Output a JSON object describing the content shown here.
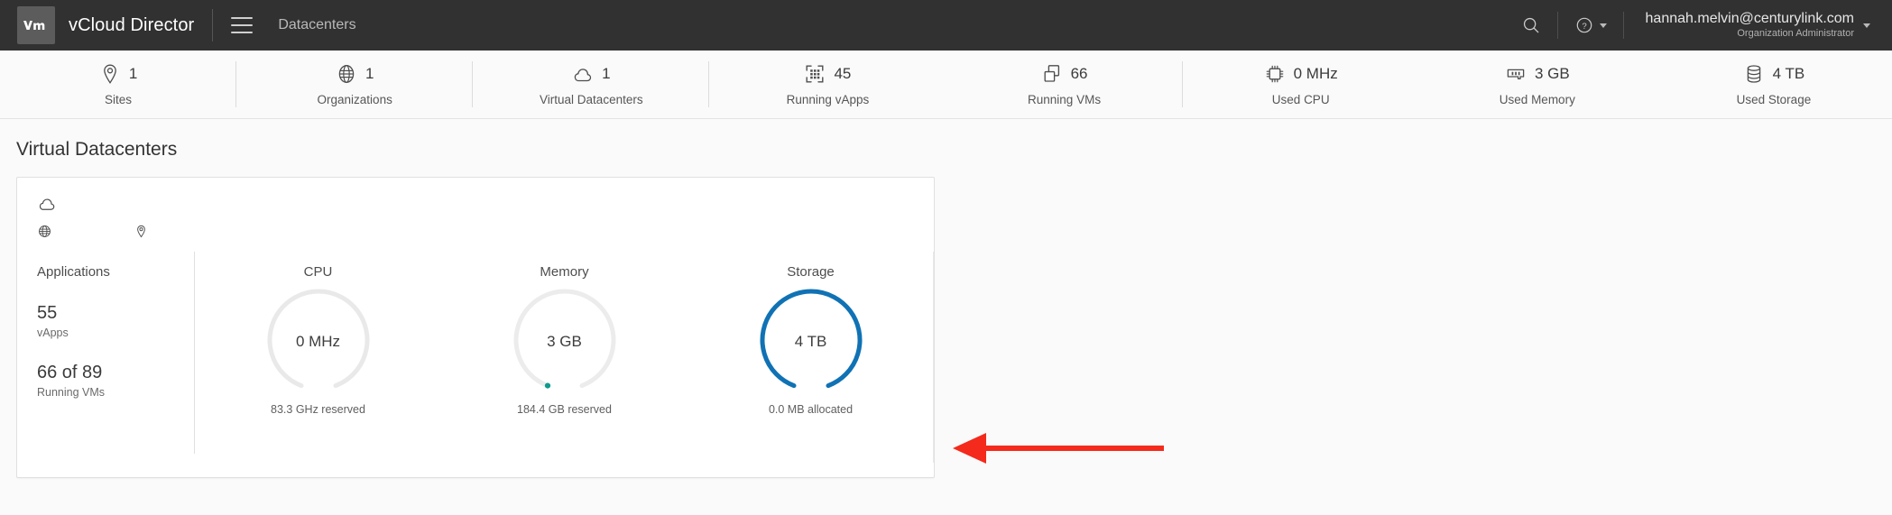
{
  "header": {
    "logo_text": "vm",
    "app_title": "vCloud Director",
    "menu_icon": "hamburger-icon",
    "breadcrumb": "Datacenters",
    "search_icon": "search-icon",
    "help_icon": "help-circle-icon",
    "user_email": "hannah.melvin@centurylink.com",
    "user_role": "Organization Administrator"
  },
  "stats": [
    {
      "icon": "location-pin-icon",
      "value": "1",
      "label": "Sites"
    },
    {
      "icon": "globe-icon",
      "value": "1",
      "label": "Organizations"
    },
    {
      "icon": "cloud-icon",
      "value": "1",
      "label": "Virtual Datacenters"
    },
    {
      "icon": "vapp-grid-icon",
      "value": "45",
      "label": "Running vApps"
    },
    {
      "icon": "vm-stack-icon",
      "value": "66",
      "label": "Running VMs"
    },
    {
      "icon": "cpu-chip-icon",
      "value": "0 MHz",
      "label": "Used CPU"
    },
    {
      "icon": "memory-stick-icon",
      "value": "3 GB",
      "label": "Used Memory"
    },
    {
      "icon": "storage-drum-icon",
      "value": "4 TB",
      "label": "Used Storage"
    }
  ],
  "page": {
    "title": "Virtual Datacenters"
  },
  "card": {
    "cloud_icon": "cloud-icon",
    "org_icon": "globe-icon",
    "org_name": "",
    "site_icon": "location-pin-icon",
    "site_name": "",
    "applications": {
      "title": "Applications",
      "vapps_count": "55",
      "vapps_label": "vApps",
      "vms_count": "66 of 89",
      "vms_label": "Running VMs"
    },
    "gauges": [
      {
        "title": "CPU",
        "center": "0 MHz",
        "footer": "83.3 GHz reserved",
        "track_color": "#e9e9e9",
        "arc_color": "#e9e9e9",
        "percent": 0,
        "dot": false
      },
      {
        "title": "Memory",
        "center": "3 GB",
        "footer": "184.4 GB reserved",
        "track_color": "#ececec",
        "arc_color": "#0f9a8c",
        "percent": 1,
        "dot": true,
        "dot_color": "#0f9a8c"
      },
      {
        "title": "Storage",
        "center": "4 TB",
        "footer": "0.0 MB allocated",
        "track_color": "#e9e9e9",
        "arc_color": "#1072b4",
        "percent": 100,
        "dot": false
      }
    ]
  },
  "annotation": {
    "type": "arrow-left",
    "color": "#f42a1c"
  }
}
